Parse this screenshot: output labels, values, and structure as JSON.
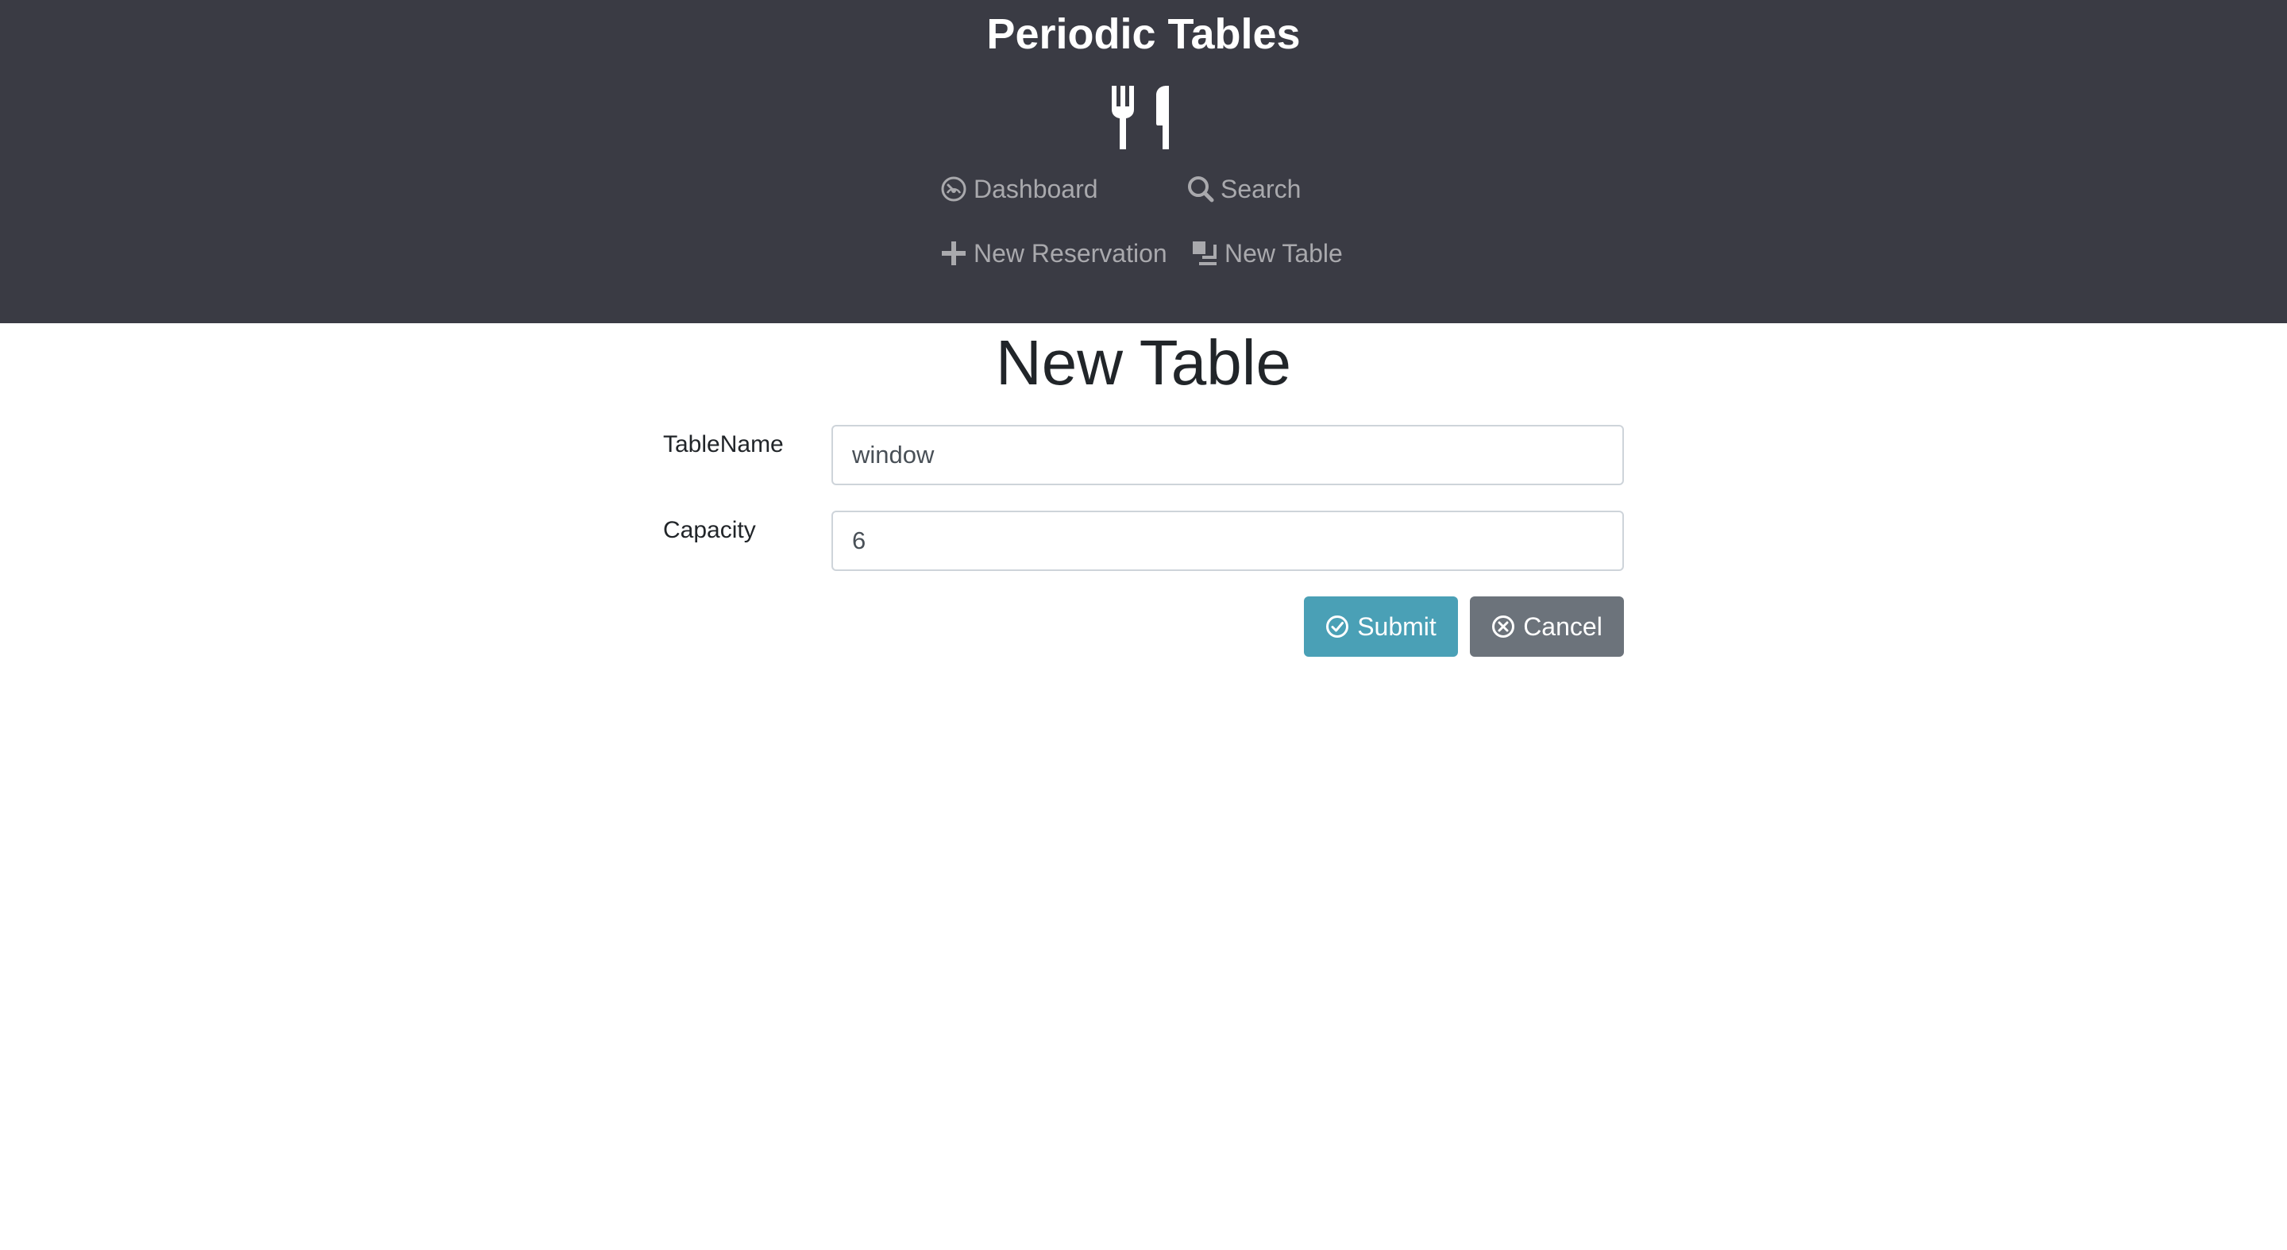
{
  "header": {
    "app_title": "Periodic Tables",
    "logo_icon": "utensils-icon",
    "nav": {
      "dashboard": {
        "label": "Dashboard",
        "icon": "dashboard-gauge-icon"
      },
      "search": {
        "label": "Search",
        "icon": "search-icon"
      },
      "new_reservation": {
        "label": "New Reservation",
        "icon": "plus-icon"
      },
      "new_table": {
        "label": "New Table",
        "icon": "layers-icon"
      }
    }
  },
  "main": {
    "page_title": "New Table",
    "form": {
      "table_name": {
        "label": "TableName",
        "value": "window"
      },
      "capacity": {
        "label": "Capacity",
        "value": "6"
      },
      "submit_label": "Submit",
      "submit_icon": "check-circle-icon",
      "cancel_label": "Cancel",
      "cancel_icon": "x-circle-icon"
    }
  },
  "colors": {
    "header_background": "#3a3b44",
    "nav_text": "#a9a9ad",
    "submit_button": "#4aa0b6",
    "cancel_button": "#6c737b"
  }
}
